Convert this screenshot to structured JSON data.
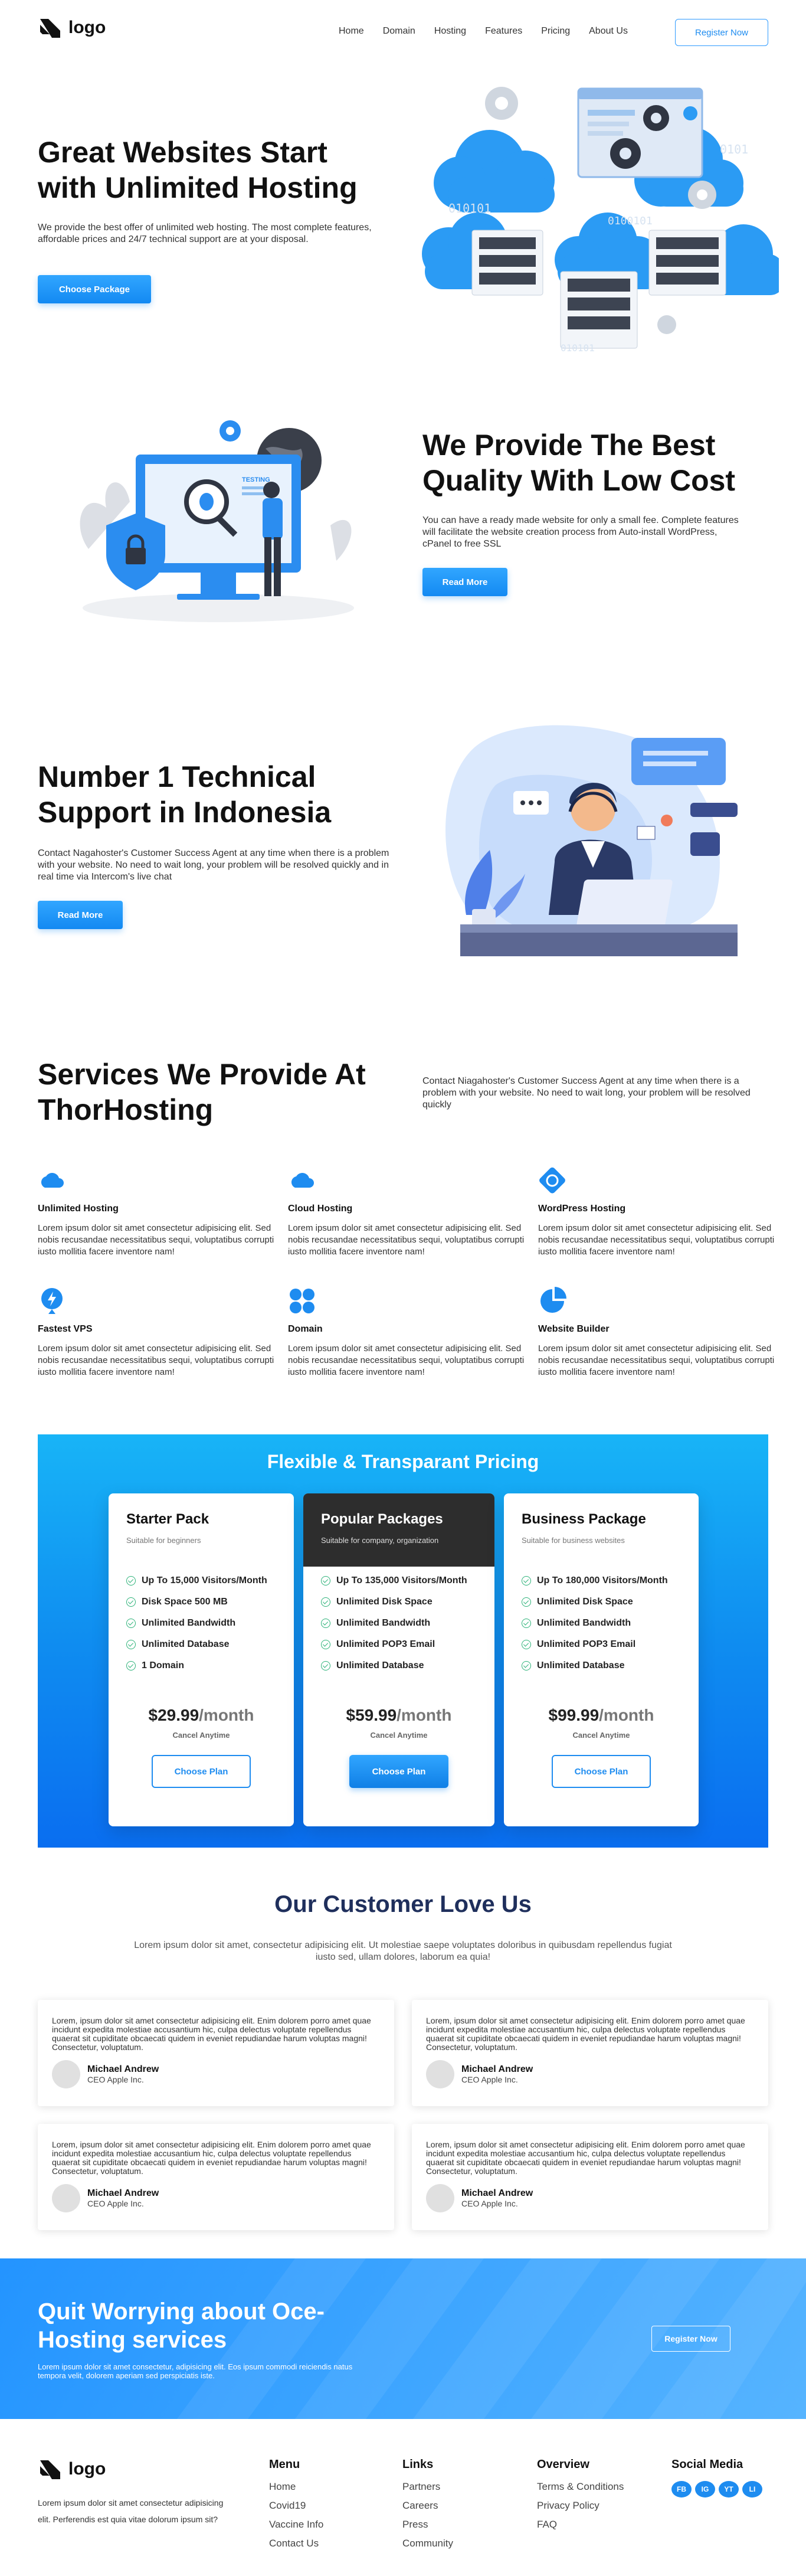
{
  "header": {
    "logo_text": "logo",
    "nav": [
      "Home",
      "Domain",
      "Hosting",
      "Features",
      "Pricing",
      "About Us"
    ],
    "register_label": "Register Now"
  },
  "hero": {
    "title_line1": "Great Websites Start",
    "title_line2": "with Unlimited Hosting",
    "text": "We provide the best offer of unlimited web hosting. The most complete features, affordable prices and 24/7 technical support are at your disposal.",
    "button": "Choose Package",
    "illustration_text": [
      "0101",
      "010101",
      "0100101",
      "010101"
    ]
  },
  "quality": {
    "title_line1": "We Provide The Best",
    "title_line2": "Quality With Low Cost",
    "text": "You can have a ready made website for only a small fee. Complete features will facilitate the website creation process from Auto-install WordPress, cPanel to free SSL",
    "button": "Read More",
    "screen_label": "TESTING"
  },
  "support": {
    "title_line1": "Number 1 Technical",
    "title_line2": "Support in Indonesia",
    "text": "Contact Nagahoster's Customer Success Agent at any time when there is a problem with your website. No need to wait long, your problem will be resolved quickly and in real time via Intercom's live chat",
    "button": "Read More"
  },
  "services": {
    "title_line1": "Services We Provide At",
    "title_line2": "ThorHosting",
    "intro": "Contact Niagahoster's Customer Success Agent at any time when there is a problem with your website. No need to wait long, your problem will be resolved quickly",
    "items": [
      {
        "icon": "cloud-icon",
        "title": "Unlimited Hosting",
        "text": "Lorem ipsum dolor sit amet consectetur adipisicing elit. Sed nobis recusandae necessitatibus sequi, voluptatibus corrupti iusto mollitia facere inventore nam!"
      },
      {
        "icon": "cloud-icon",
        "title": "Cloud Hosting",
        "text": "Lorem ipsum dolor sit amet consectetur adipisicing elit. Sed nobis recusandae necessitatibus sequi, voluptatibus corrupti iusto mollitia facere inventore nam!"
      },
      {
        "icon": "wordpress-icon",
        "title": "WordPress Hosting",
        "text": "Lorem ipsum dolor sit amet consectetur adipisicing elit. Sed nobis recusandae necessitatibus sequi, voluptatibus corrupti iusto mollitia facere inventore nam!"
      },
      {
        "icon": "lightning-icon",
        "title": "Fastest VPS",
        "text": "Lorem ipsum dolor sit amet consectetur adipisicing elit. Sed nobis recusandae necessitatibus sequi, voluptatibus corrupti iusto mollitia facere inventore nam!"
      },
      {
        "icon": "grid-icon",
        "title": "Domain",
        "text": "Lorem ipsum dolor sit amet consectetur adipisicing elit. Sed nobis recusandae necessitatibus sequi, voluptatibus corrupti iusto mollitia facere inventore nam!"
      },
      {
        "icon": "pie-icon",
        "title": "Website Builder",
        "text": "Lorem ipsum dolor sit amet consectetur adipisicing elit. Sed nobis recusandae necessitatibus sequi, voluptatibus corrupti iusto mollitia facere inventore nam!"
      }
    ]
  },
  "pricing": {
    "title": "Flexible & Transparant Pricing",
    "plans": [
      {
        "name": "Starter Pack",
        "sub": "Suitable for beginners",
        "features": [
          "Up To 15,000 Visitors/Month",
          "Disk Space 500 MB",
          "Unlimited Bandwidth",
          "Unlimited Database",
          "1 Domain"
        ],
        "price": "$29.99",
        "per": "/month",
        "cancel": "Cancel Anytime",
        "button": "Choose Plan"
      },
      {
        "name": "Popular Packages",
        "sub": "Suitable for company, organization",
        "features": [
          "Up To 135,000 Visitors/Month",
          "Unlimited Disk Space",
          "Unlimited Bandwidth",
          "Unlimited POP3 Email",
          "Unlimited Database"
        ],
        "price": "$59.99",
        "per": "/month",
        "cancel": "Cancel Anytime",
        "button": "Choose Plan"
      },
      {
        "name": "Business Package",
        "sub": "Suitable for business websites",
        "features": [
          "Up To 180,000 Visitors/Month",
          "Unlimited Disk Space",
          "Unlimited Bandwidth",
          "Unlimited POP3 Email",
          "Unlimited Database"
        ],
        "price": "$99.99",
        "per": "/month",
        "cancel": "Cancel Anytime",
        "button": "Choose Plan"
      }
    ]
  },
  "testimonials": {
    "title": "Our Customer Love Us",
    "subtitle": "Lorem ipsum dolor sit amet, consectetur adipisicing elit. Ut molestiae saepe voluptates doloribus in quibusdam repellendus fugiat iusto sed, ullam dolores, laborum ea quia!",
    "items": [
      {
        "text": "Lorem, ipsum dolor sit amet consectetur adipisicing elit. Enim dolorem porro amet quae incidunt expedita molestiae accusantium hic, culpa delectus voluptate repellendus quaerat sit cupiditate obcaecati quidem in eveniet repudiandae harum voluptas magni! Consectetur, voluptatum.",
        "name": "Michael Andrew",
        "role": "CEO Apple Inc."
      },
      {
        "text": "Lorem, ipsum dolor sit amet consectetur adipisicing elit. Enim dolorem porro amet quae incidunt expedita molestiae accusantium hic, culpa delectus voluptate repellendus quaerat sit cupiditate obcaecati quidem in eveniet repudiandae harum voluptas magni! Consectetur, voluptatum.",
        "name": "Michael Andrew",
        "role": "CEO Apple Inc."
      },
      {
        "text": "Lorem, ipsum dolor sit amet consectetur adipisicing elit. Enim dolorem porro amet quae incidunt expedita molestiae accusantium hic, culpa delectus voluptate repellendus quaerat sit cupiditate obcaecati quidem in eveniet repudiandae harum voluptas magni! Consectetur, voluptatum.",
        "name": "Michael Andrew",
        "role": "CEO Apple Inc."
      },
      {
        "text": "Lorem, ipsum dolor sit amet consectetur adipisicing elit. Enim dolorem porro amet quae incidunt expedita molestiae accusantium hic, culpa delectus voluptate repellendus quaerat sit cupiditate obcaecati quidem in eveniet repudiandae harum voluptas magni! Consectetur, voluptatum.",
        "name": "Michael Andrew",
        "role": "CEO Apple Inc."
      }
    ]
  },
  "cta": {
    "title_line1": "Quit Worrying about Oce-",
    "title_line2": "Hosting services",
    "text": "Lorem ipsum dolor sit amet consectetur, adipisicing elit. Eos ipsum commodi reiciendis natus tempora velit, dolorem aperiam sed perspiciatis iste.",
    "button": "Register Now"
  },
  "footer": {
    "logo_text": "logo",
    "about": "Lorem ipsum dolor sit amet consectetur adipisicing elit. Perferendis est quia vitae dolorum ipsum sit?",
    "menu_title": "Menu",
    "menu": [
      "Home",
      "Covid19",
      "Vaccine Info",
      "Contact Us"
    ],
    "links_title": "Links",
    "links": [
      "Partners",
      "Careers",
      "Press",
      "Community"
    ],
    "overview_title": "Overview",
    "overview": [
      "Terms & Conditions",
      "Privacy Policy",
      "FAQ"
    ],
    "social_title": "Social Media",
    "social": [
      "FB",
      "IG",
      "YT",
      "LI"
    ]
  },
  "colors": {
    "accent": "#1e8cf0",
    "pricing_band": "#0f8df0",
    "dark_card": "#2d2d2d"
  }
}
